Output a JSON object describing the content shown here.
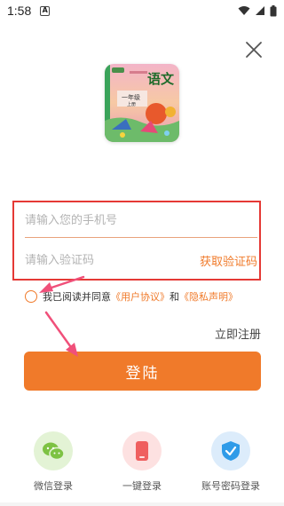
{
  "status_bar": {
    "time": "1:58",
    "notification_icon": "a-icon"
  },
  "login": {
    "close_icon": "close-icon",
    "phone_placeholder": "请输入您的手机号",
    "code_placeholder": "请输入验证码",
    "get_code_label": "获取验证码",
    "agreement_prefix": "我已阅读并同意",
    "user_agreement_label": "《用户协议》",
    "and_label": "和",
    "privacy_label": "《隐私声明》",
    "register_label": "立即注册",
    "login_button_label": "登陆"
  },
  "logo": {
    "title_text": "语文",
    "grade_text": "一年级",
    "term_text": "上册"
  },
  "other_methods": [
    {
      "label": "微信登录",
      "icon": "wechat-icon",
      "color": "#7dc243",
      "bg": "#e3f3d5"
    },
    {
      "label": "一键登录",
      "icon": "phone-icon",
      "color": "#ef5f5f",
      "bg": "#fde1e1"
    },
    {
      "label": "账号密码登录",
      "icon": "shield-icon",
      "color": "#2f9be8",
      "bg": "#dcecfb"
    }
  ],
  "colors": {
    "accent": "#f07a2a",
    "highlight_box": "#e53935"
  }
}
